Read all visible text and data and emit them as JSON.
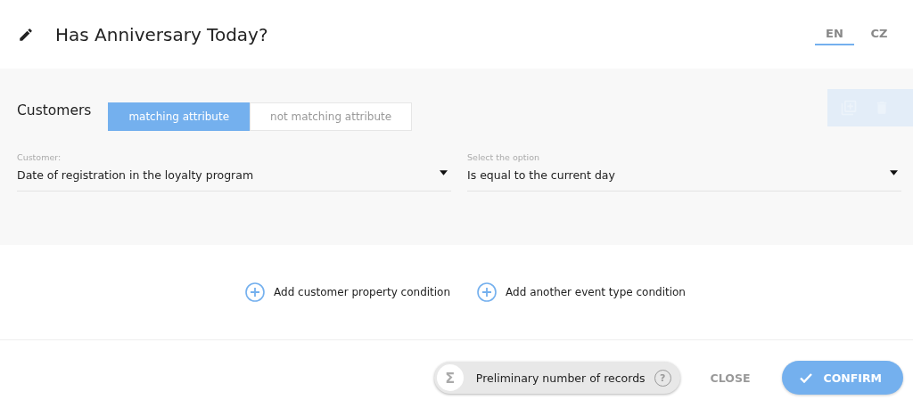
{
  "header": {
    "title": "Has Anniversary Today?",
    "languages": [
      {
        "label": "EN",
        "selected": true
      },
      {
        "label": "CZ",
        "selected": false
      }
    ]
  },
  "condition": {
    "entity": "Customers",
    "modes": [
      {
        "label": "matching attribute",
        "selected": true
      },
      {
        "label": "not matching attribute",
        "selected": false
      }
    ],
    "actions": {
      "disabled": true
    },
    "fields": [
      {
        "label": "Customer:",
        "value": "Date of registration in the loyalty program"
      },
      {
        "label": "Select the option",
        "value": "Is equal to the current day"
      }
    ]
  },
  "add_actions": [
    "Add customer property condition",
    "Add another event type condition"
  ],
  "footer": {
    "records": {
      "symbol": "Σ",
      "label": "Preliminary number of records",
      "help": "?"
    },
    "close": "CLOSE",
    "confirm": "CONFIRM"
  }
}
